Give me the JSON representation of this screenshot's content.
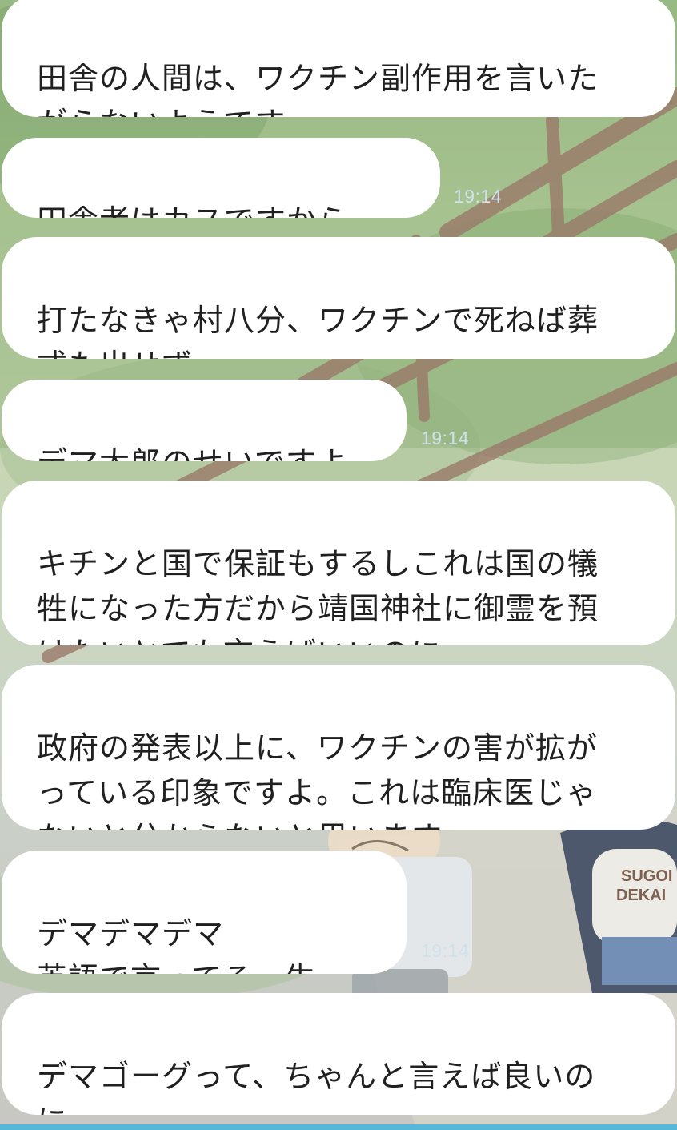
{
  "chat": {
    "messages": [
      {
        "text": "田舎の人間は、ワクチン副作用を言いた\nがらないようです。",
        "time": ""
      },
      {
        "text": "田舎者はカスですから。",
        "time": "19:14"
      },
      {
        "text": "打たなきゃ村八分、ワクチンで死ねば葬\n式も出せず。",
        "time": ""
      },
      {
        "text": "デマ太郎のせいですよ",
        "time": "19:14"
      },
      {
        "text": "キチンと国で保証もするしこれは国の犠\n牲になった方だから靖国神社に御霊を預\nけたいとでも言えばいいのに",
        "time": ""
      },
      {
        "text": "政府の発表以上に、ワクチンの害が拡が\nっている印象ですよ。これは臨床医じゃ\nないと分からないと思います。",
        "time": ""
      },
      {
        "text": "デマデマデマ\n英語で言ってろ一生。",
        "time": "19:14"
      },
      {
        "text": "デマゴーグって、ちゃんと言えば良いの\nにｗ",
        "time": ""
      }
    ],
    "background": {
      "shirt_text": "SUGOI\nDEKAI"
    }
  },
  "colors": {
    "bubble": "#ffffff",
    "text": "#202020",
    "timestamp": "#cfe2ec",
    "accent_bar": "#57b7d9"
  }
}
